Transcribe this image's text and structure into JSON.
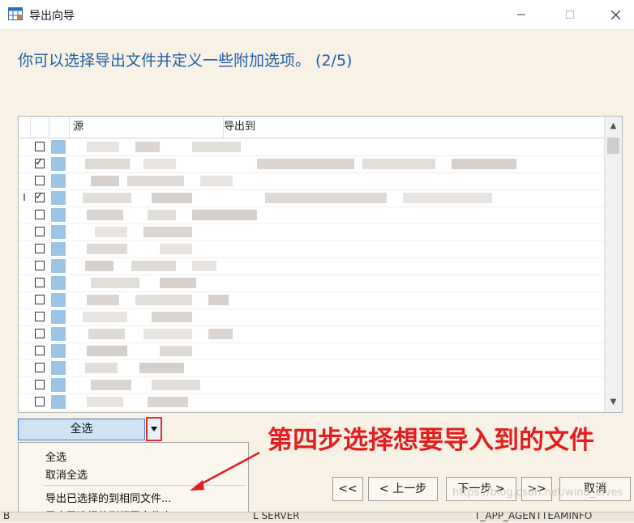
{
  "window": {
    "title": "导出向导"
  },
  "heading": "你可以选择导出文件并定义一些附加选项。 (2/5)",
  "grid": {
    "columns": [
      "源",
      "导出到"
    ],
    "rows": [
      {
        "checked": false,
        "marker": ""
      },
      {
        "checked": true,
        "marker": ""
      },
      {
        "checked": false,
        "marker": ""
      },
      {
        "checked": true,
        "marker": "I"
      },
      {
        "checked": false,
        "marker": ""
      },
      {
        "checked": false,
        "marker": ""
      },
      {
        "checked": false,
        "marker": ""
      },
      {
        "checked": false,
        "marker": ""
      },
      {
        "checked": false,
        "marker": ""
      },
      {
        "checked": false,
        "marker": ""
      },
      {
        "checked": false,
        "marker": ""
      },
      {
        "checked": false,
        "marker": ""
      },
      {
        "checked": false,
        "marker": ""
      },
      {
        "checked": false,
        "marker": ""
      },
      {
        "checked": false,
        "marker": ""
      },
      {
        "checked": false,
        "marker": ""
      }
    ]
  },
  "select_all_button": "全选",
  "dropdown_menu": {
    "items": [
      "全选",
      "取消全选",
      "导出已选择的到相同文件...",
      "导出已选择的到相同文件夹..."
    ]
  },
  "annotation": "第四步选择想要导入到的文件",
  "buttons": {
    "first": "<<",
    "prev": "< 上一步",
    "next": "下一步 >",
    "last": ">>",
    "cancel": "取消"
  },
  "footer": {
    "left": "B",
    "mid": "L SERVER",
    "right": "T_APP_AGENTTEAMINFO"
  },
  "watermark": "https://blog.csdn.net/wind_elves",
  "colors": {
    "heading": "#1f5fa8",
    "annotation": "#e41d1d",
    "selected_button": "#cfe3f4",
    "background": "#f8f1e6"
  }
}
